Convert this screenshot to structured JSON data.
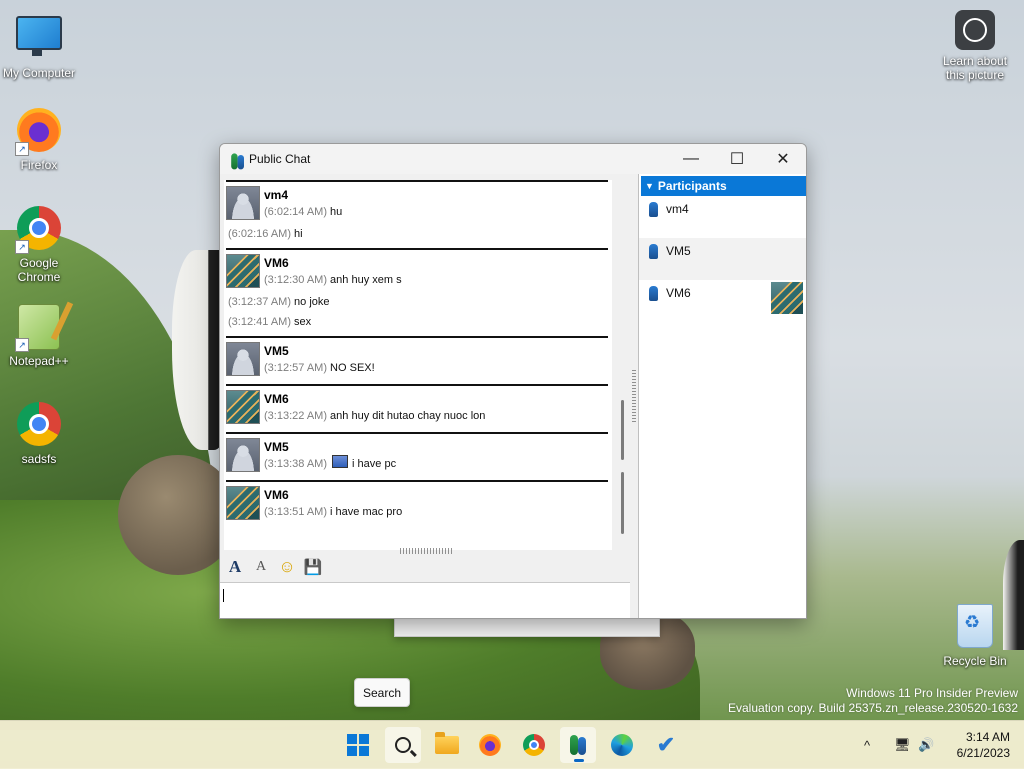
{
  "desktop": {
    "icons": [
      {
        "label": "My Computer",
        "icon": "monitor-icon"
      },
      {
        "label": "Firefox",
        "icon": "firefox-icon"
      },
      {
        "label": "Google Chrome",
        "icon": "chrome-icon"
      },
      {
        "label": "Notepad++",
        "icon": "notepadpp-icon"
      },
      {
        "label": "sadsfs",
        "icon": "chrome-icon"
      }
    ],
    "learn": {
      "line1": "Learn about",
      "line2": "this picture"
    },
    "recycle_bin": "Recycle Bin",
    "watermark": {
      "line1": "Windows 11 Pro Insider Preview",
      "line2": "Evaluation copy. Build 25375.zn_release.230520-1632"
    }
  },
  "chat_window": {
    "title": "Public Chat",
    "controls": {
      "minimize": "—",
      "maximize": "☐",
      "close": "✕"
    },
    "messages": [
      {
        "sender": "vm4",
        "avatar": "default",
        "lines": [
          {
            "time": "(6:02:14 AM)",
            "text": "hu"
          },
          {
            "time": "(6:02:16 AM)",
            "text": "hi"
          }
        ]
      },
      {
        "sender": "VM6",
        "avatar": "stairs",
        "lines": [
          {
            "time": "(3:12:30 AM)",
            "text": "anh huy xem s"
          },
          {
            "time": "(3:12:37 AM)",
            "text": "no joke"
          },
          {
            "time": "(3:12:41 AM)",
            "text": "sex"
          }
        ]
      },
      {
        "sender": "VM5",
        "avatar": "default",
        "lines": [
          {
            "time": "(3:12:57 AM)",
            "text": "NO SEX!"
          }
        ]
      },
      {
        "sender": "VM6",
        "avatar": "stairs",
        "lines": [
          {
            "time": "(3:13:22 AM)",
            "text": "anh huy dit hutao chay nuoc lon"
          }
        ]
      },
      {
        "sender": "VM5",
        "avatar": "default",
        "lines": [
          {
            "time": "(3:13:38 AM)",
            "text": "i have pc",
            "icon": "computer-emoticon-icon"
          }
        ]
      },
      {
        "sender": "VM6",
        "avatar": "stairs",
        "lines": [
          {
            "time": "(3:13:51 AM)",
            "text": "i have mac pro"
          }
        ]
      }
    ],
    "toolbar": {
      "font": "A",
      "font_color": "A",
      "emoticon": "☺",
      "save": "💾"
    },
    "input_value": "",
    "participants": {
      "header": "Participants",
      "items": [
        {
          "name": "vm4",
          "thumb": false
        },
        {
          "name": "VM5",
          "thumb": false
        },
        {
          "name": "VM6",
          "thumb": true
        }
      ]
    }
  },
  "tooltip": "Search",
  "taskbar": {
    "apps": [
      "start-icon",
      "search-icon",
      "file-explorer-icon",
      "firefox-icon",
      "chrome-icon",
      "chat-app-icon",
      "edge-icon",
      "todo-icon"
    ],
    "tray": {
      "chevron": "^",
      "network": "🖥",
      "volume": "🔊"
    },
    "clock": {
      "time": "3:14 AM",
      "date": "6/21/2023"
    }
  }
}
